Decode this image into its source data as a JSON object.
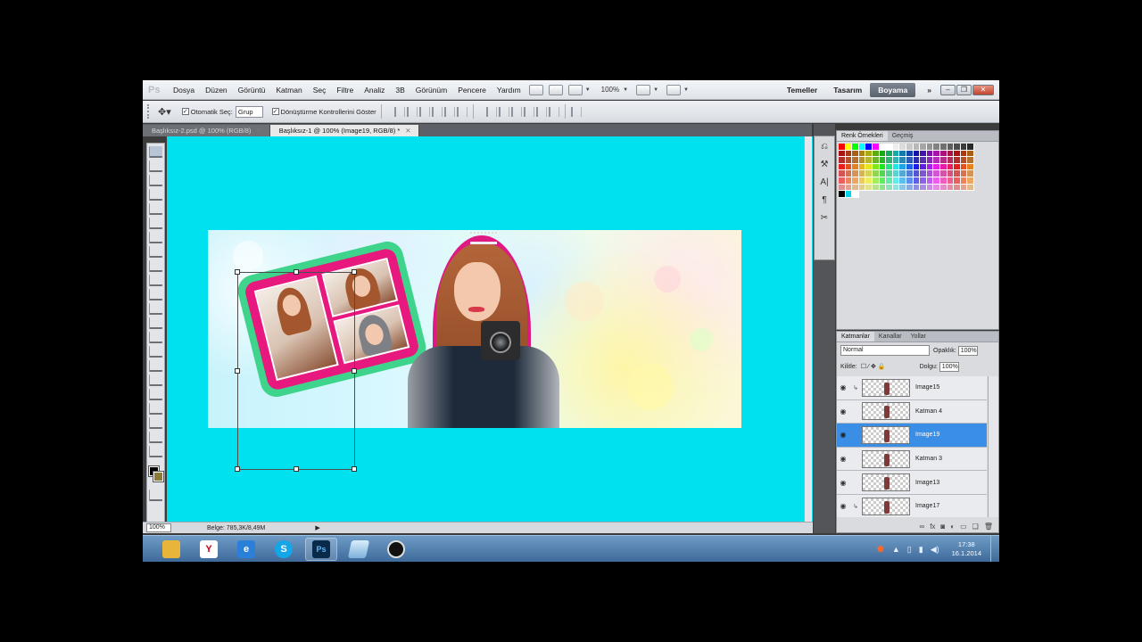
{
  "menubar": {
    "logo": "Ps",
    "items": [
      "Dosya",
      "Düzen",
      "Görüntü",
      "Katman",
      "Seç",
      "Filtre",
      "Analiz",
      "3B",
      "Görünüm",
      "Pencere",
      "Yardım"
    ],
    "zoom": "100%",
    "workspaces": [
      "Temeller",
      "Tasarım",
      "Boyama"
    ],
    "more": "»"
  },
  "options": {
    "auto_select_label": "Otomatik Seç:",
    "auto_select_value": "Grup",
    "transform_controls_label": "Dönüştürme Kontrollerini Göster"
  },
  "doc_tabs": [
    {
      "label": "Başlıksız-2.psd @ 100% (RGB/8)"
    },
    {
      "label": "Başlıksız-1 @ 100% (Image19, RGB/8) *"
    }
  ],
  "status": {
    "zoom": "100%",
    "doc_info": "Belge: 785,3K/8,49M"
  },
  "swatches_panel": {
    "tabs": [
      "Renk Örnekleri",
      "Geçmiş"
    ]
  },
  "layers_panel": {
    "tabs": [
      "Katmanlar",
      "Kanallar",
      "Yollar"
    ],
    "blend_mode": "Normal",
    "opacity_label": "Opaklık:",
    "opacity_value": "100%",
    "lock_label": "Kilitle:",
    "fill_label": "Dolgu:",
    "fill_value": "100%",
    "layers": [
      {
        "name": "Image15",
        "clipped": true,
        "selected": false
      },
      {
        "name": "Katman 4",
        "clipped": false,
        "selected": false
      },
      {
        "name": "Image19",
        "clipped": false,
        "selected": true
      },
      {
        "name": "Katman 3",
        "clipped": false,
        "selected": false
      },
      {
        "name": "Image13",
        "clipped": false,
        "selected": false
      },
      {
        "name": "Image17",
        "clipped": true,
        "selected": false
      }
    ]
  },
  "taskbar": {
    "apps": [
      "explorer",
      "yandex",
      "internet-explorer",
      "skype",
      "photoshop",
      "app",
      "camera-app"
    ],
    "time": "17:38",
    "date": "16.1.2014"
  },
  "colors": {
    "canvas_background": "#00e1f0",
    "selected_layer": "#3a8ee6",
    "collage_frame_outer": "#3fd48b",
    "collage_frame_inner": "#e7197e"
  }
}
